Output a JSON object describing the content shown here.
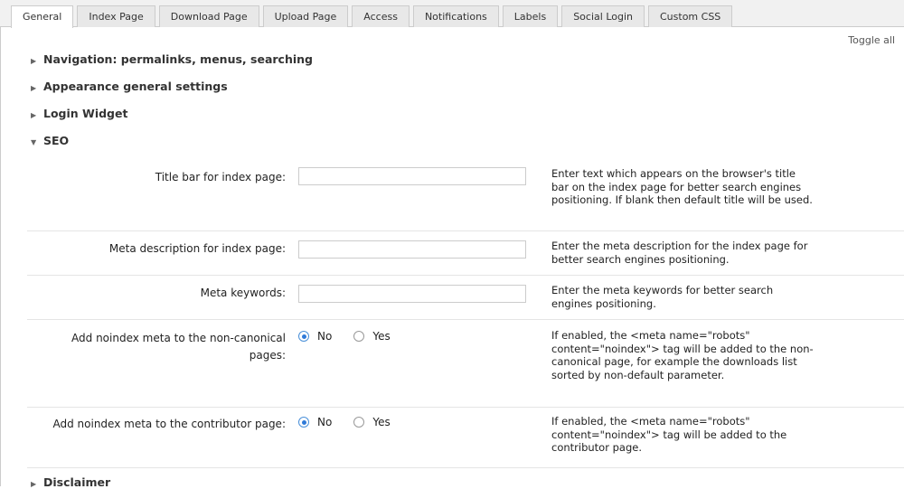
{
  "tabs": [
    "General",
    "Index Page",
    "Download Page",
    "Upload Page",
    "Access",
    "Notifications",
    "Labels",
    "Social Login",
    "Custom CSS"
  ],
  "toggle_all": "Toggle all",
  "sections": {
    "navigation": "Navigation: permalinks, menus, searching",
    "appearance": "Appearance general settings",
    "login_widget": "Login Widget",
    "seo": "SEO",
    "disclaimer": "Disclaimer"
  },
  "seo": {
    "title_bar": {
      "label": "Title bar for index page:",
      "value": "",
      "desc": "Enter text which appears on the browser's title bar on the index page for better search engines positioning. If blank then default title will be used."
    },
    "meta_description": {
      "label": "Meta description for index page:",
      "value": "",
      "desc": "Enter the meta description for the index page for better search engines positioning."
    },
    "meta_keywords": {
      "label": "Meta keywords:",
      "value": "",
      "desc": "Enter the meta keywords for better search engines positioning."
    },
    "noindex_noncanonical": {
      "label": "Add noindex meta to the non-canonical pages:",
      "option_no": "No",
      "option_yes": "Yes",
      "selected": "No",
      "desc": "If enabled, the <meta name=\"robots\" content=\"noindex\"> tag will be added to the non-canonical page, for example the downloads list sorted by non-default parameter."
    },
    "noindex_contributor": {
      "label": "Add noindex meta to the contributor page:",
      "option_no": "No",
      "option_yes": "Yes",
      "selected": "No",
      "desc": "If enabled, the <meta name=\"robots\" content=\"noindex\"> tag will be added to the contributor page."
    }
  }
}
